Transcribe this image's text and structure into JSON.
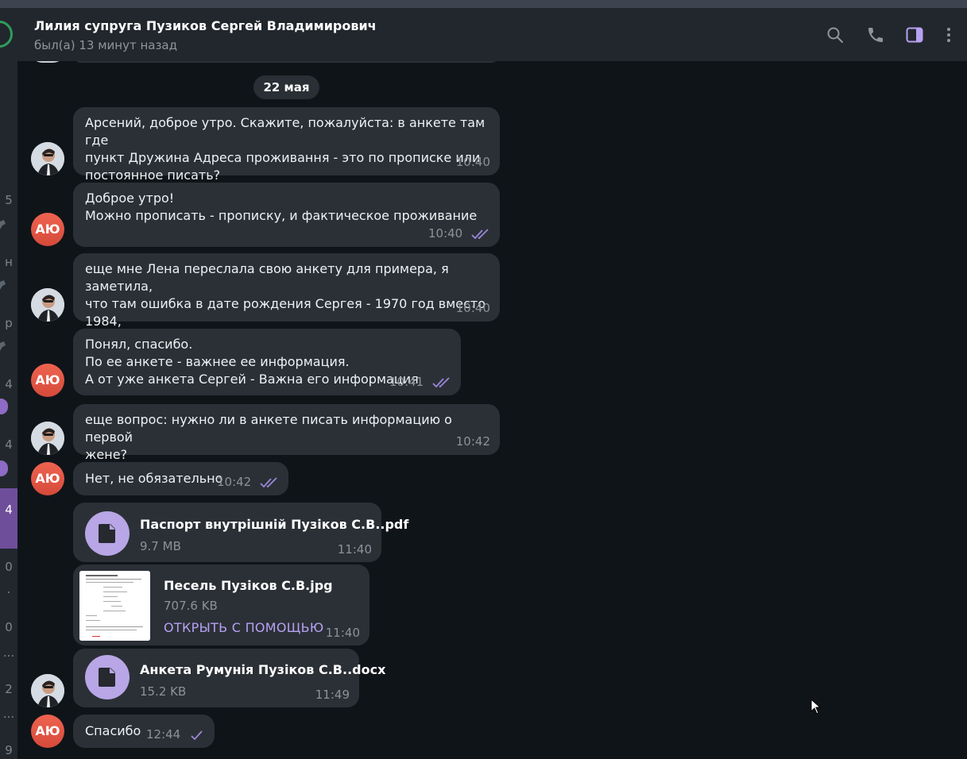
{
  "header": {
    "contact_name": "Лилия супруга Пузиков Сергей Владимирович",
    "status": "был(а) 13 минут назад",
    "icons": [
      "search-icon",
      "phone-icon",
      "sidebar-toggle-icon",
      "more-vertical-icon"
    ]
  },
  "sidebar_fragments": [
    "5",
    "н",
    "р",
    "4",
    "4",
    "4",
    "0",
    ".",
    "0",
    "...",
    "2",
    "...",
    "9"
  ],
  "date_divider": "22 мая",
  "messages": [
    {
      "from": "contact",
      "text": "Арсений, доброе утро. Скажите, пожалуйста: в анкете там где\nпункт Дружина Адреса проживання - это по прописке или\nпостоянное писать?",
      "time": "10:40"
    },
    {
      "from": "me",
      "avatar": "АЮ",
      "text": "Доброе утро!\nМожно прописать - прописку, и фактическое проживание",
      "time": "10:40",
      "status": "read"
    },
    {
      "from": "contact",
      "text": "еще мне Лена переслала свою анкету для примера, я заметила,\nчто там ошибка в дате рождения Сергея  - 1970 год вместо 1984,\nна всякий случай пишу.",
      "time": "10:40"
    },
    {
      "from": "me",
      "avatar": "АЮ",
      "text": "Понял, спасибо.\nПо ее анкете - важнее ее информация.\nА от уже анкета Сергей - Важна его информация",
      "time": "10:41",
      "status": "read"
    },
    {
      "from": "contact",
      "text": "еще вопрос: нужно ли в анкете писать информацию о первой\nжене?",
      "time": "10:42"
    },
    {
      "from": "me",
      "avatar": "АЮ",
      "text": "Нет, не обязательно",
      "time": "10:42",
      "status": "read"
    },
    {
      "from": "contact",
      "type": "file",
      "name": "Паспорт внутрішній Пузіков С.В..pdf",
      "size": "9.7 MB",
      "time": "11:40"
    },
    {
      "from": "contact",
      "type": "image-file",
      "name": "Песель Пузіков С.В.jpg",
      "size": "707.6 KB",
      "action": "ОТКРЫТЬ С ПОМОЩЬЮ",
      "time": "11:40"
    },
    {
      "from": "contact",
      "type": "file",
      "name": "Анкета Румунія Пузіков С.В..docx",
      "size": "15.2 KB",
      "time": "11:49"
    },
    {
      "from": "me",
      "avatar": "АЮ",
      "text": "Спасибо",
      "time": "12:44",
      "status": "sent"
    }
  ],
  "colors": {
    "accent": "#b7a1f3",
    "bubble": "#2b3036",
    "header": "#22272d",
    "chat_background": "#0f1419",
    "avatar_me": "#e0553f",
    "file_icon": "#b8a6e6"
  }
}
